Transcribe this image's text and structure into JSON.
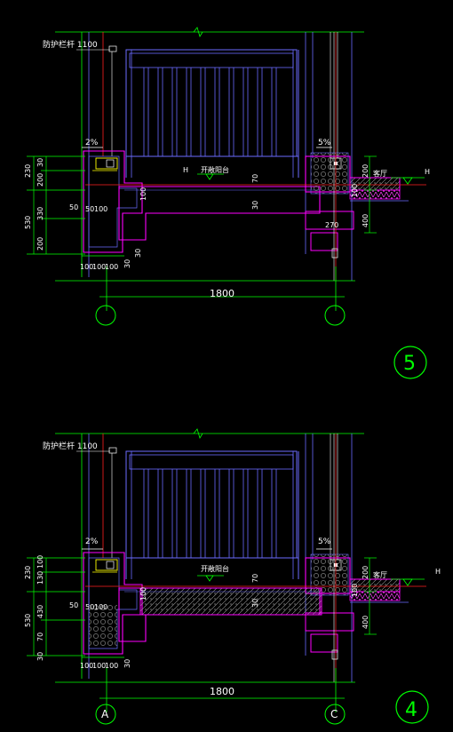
{
  "drawings": [
    {
      "id": "5",
      "labels": {
        "railing": "防护栏杆 1100",
        "slope_left": "2%",
        "slope_right": "5%",
        "balcony": "开敞阳台",
        "hall": "客厅",
        "h_left": "H",
        "h_right": "H",
        "total_span": "1800",
        "axis_left": "",
        "axis_right": "",
        "detail_no": "5"
      },
      "dims_left": [
        "230",
        "30",
        "200",
        "530",
        "330",
        "200"
      ],
      "dims_inner": [
        "50",
        "50",
        "100"
      ],
      "dims_bottom": [
        "100",
        "100",
        "100",
        "30",
        "30"
      ],
      "dims_mid": [
        "70",
        "30",
        "100"
      ],
      "dims_right": [
        "200",
        "100",
        "400",
        "270"
      ]
    },
    {
      "id": "4",
      "labels": {
        "railing": "防护栏杆 1100",
        "slope_left": "2%",
        "slope_right": "5%",
        "balcony": "开敞阳台",
        "hall": "客厅",
        "h_left": "",
        "h_right": "H",
        "total_span": "1800",
        "axis_left": "A",
        "axis_right": "C",
        "detail_no": "4"
      },
      "dims_left": [
        "230",
        "100",
        "130",
        "530",
        "430",
        "70",
        "30"
      ],
      "dims_inner": [
        "50",
        "50",
        "100"
      ],
      "dims_bottom": [
        "100",
        "100",
        "100",
        "30"
      ],
      "dims_mid": [
        "70",
        "30",
        "100"
      ],
      "dims_right": [
        "200",
        "100",
        "400"
      ]
    }
  ],
  "colors": {
    "background": "#000000",
    "structure": "#ff00ff",
    "railing": "#6b6bff",
    "dimension": "#00ff00",
    "axis": "#ff2020",
    "text": "#ffffff",
    "note": "#ffff00",
    "fill": "#c0c0c0"
  }
}
